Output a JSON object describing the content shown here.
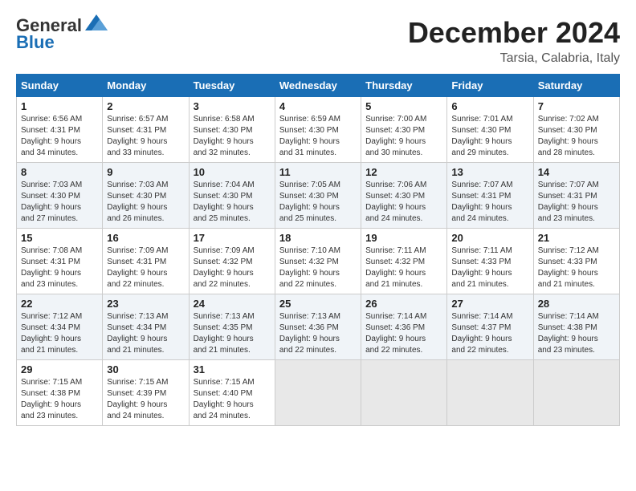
{
  "header": {
    "logo_line1": "General",
    "logo_line2": "Blue",
    "month": "December 2024",
    "location": "Tarsia, Calabria, Italy"
  },
  "weekdays": [
    "Sunday",
    "Monday",
    "Tuesday",
    "Wednesday",
    "Thursday",
    "Friday",
    "Saturday"
  ],
  "weeks": [
    [
      {
        "day": "1",
        "info": "Sunrise: 6:56 AM\nSunset: 4:31 PM\nDaylight: 9 hours\nand 34 minutes."
      },
      {
        "day": "2",
        "info": "Sunrise: 6:57 AM\nSunset: 4:31 PM\nDaylight: 9 hours\nand 33 minutes."
      },
      {
        "day": "3",
        "info": "Sunrise: 6:58 AM\nSunset: 4:30 PM\nDaylight: 9 hours\nand 32 minutes."
      },
      {
        "day": "4",
        "info": "Sunrise: 6:59 AM\nSunset: 4:30 PM\nDaylight: 9 hours\nand 31 minutes."
      },
      {
        "day": "5",
        "info": "Sunrise: 7:00 AM\nSunset: 4:30 PM\nDaylight: 9 hours\nand 30 minutes."
      },
      {
        "day": "6",
        "info": "Sunrise: 7:01 AM\nSunset: 4:30 PM\nDaylight: 9 hours\nand 29 minutes."
      },
      {
        "day": "7",
        "info": "Sunrise: 7:02 AM\nSunset: 4:30 PM\nDaylight: 9 hours\nand 28 minutes."
      }
    ],
    [
      {
        "day": "8",
        "info": "Sunrise: 7:03 AM\nSunset: 4:30 PM\nDaylight: 9 hours\nand 27 minutes."
      },
      {
        "day": "9",
        "info": "Sunrise: 7:03 AM\nSunset: 4:30 PM\nDaylight: 9 hours\nand 26 minutes."
      },
      {
        "day": "10",
        "info": "Sunrise: 7:04 AM\nSunset: 4:30 PM\nDaylight: 9 hours\nand 25 minutes."
      },
      {
        "day": "11",
        "info": "Sunrise: 7:05 AM\nSunset: 4:30 PM\nDaylight: 9 hours\nand 25 minutes."
      },
      {
        "day": "12",
        "info": "Sunrise: 7:06 AM\nSunset: 4:30 PM\nDaylight: 9 hours\nand 24 minutes."
      },
      {
        "day": "13",
        "info": "Sunrise: 7:07 AM\nSunset: 4:31 PM\nDaylight: 9 hours\nand 24 minutes."
      },
      {
        "day": "14",
        "info": "Sunrise: 7:07 AM\nSunset: 4:31 PM\nDaylight: 9 hours\nand 23 minutes."
      }
    ],
    [
      {
        "day": "15",
        "info": "Sunrise: 7:08 AM\nSunset: 4:31 PM\nDaylight: 9 hours\nand 23 minutes."
      },
      {
        "day": "16",
        "info": "Sunrise: 7:09 AM\nSunset: 4:31 PM\nDaylight: 9 hours\nand 22 minutes."
      },
      {
        "day": "17",
        "info": "Sunrise: 7:09 AM\nSunset: 4:32 PM\nDaylight: 9 hours\nand 22 minutes."
      },
      {
        "day": "18",
        "info": "Sunrise: 7:10 AM\nSunset: 4:32 PM\nDaylight: 9 hours\nand 22 minutes."
      },
      {
        "day": "19",
        "info": "Sunrise: 7:11 AM\nSunset: 4:32 PM\nDaylight: 9 hours\nand 21 minutes."
      },
      {
        "day": "20",
        "info": "Sunrise: 7:11 AM\nSunset: 4:33 PM\nDaylight: 9 hours\nand 21 minutes."
      },
      {
        "day": "21",
        "info": "Sunrise: 7:12 AM\nSunset: 4:33 PM\nDaylight: 9 hours\nand 21 minutes."
      }
    ],
    [
      {
        "day": "22",
        "info": "Sunrise: 7:12 AM\nSunset: 4:34 PM\nDaylight: 9 hours\nand 21 minutes."
      },
      {
        "day": "23",
        "info": "Sunrise: 7:13 AM\nSunset: 4:34 PM\nDaylight: 9 hours\nand 21 minutes."
      },
      {
        "day": "24",
        "info": "Sunrise: 7:13 AM\nSunset: 4:35 PM\nDaylight: 9 hours\nand 21 minutes."
      },
      {
        "day": "25",
        "info": "Sunrise: 7:13 AM\nSunset: 4:36 PM\nDaylight: 9 hours\nand 22 minutes."
      },
      {
        "day": "26",
        "info": "Sunrise: 7:14 AM\nSunset: 4:36 PM\nDaylight: 9 hours\nand 22 minutes."
      },
      {
        "day": "27",
        "info": "Sunrise: 7:14 AM\nSunset: 4:37 PM\nDaylight: 9 hours\nand 22 minutes."
      },
      {
        "day": "28",
        "info": "Sunrise: 7:14 AM\nSunset: 4:38 PM\nDaylight: 9 hours\nand 23 minutes."
      }
    ],
    [
      {
        "day": "29",
        "info": "Sunrise: 7:15 AM\nSunset: 4:38 PM\nDaylight: 9 hours\nand 23 minutes."
      },
      {
        "day": "30",
        "info": "Sunrise: 7:15 AM\nSunset: 4:39 PM\nDaylight: 9 hours\nand 24 minutes."
      },
      {
        "day": "31",
        "info": "Sunrise: 7:15 AM\nSunset: 4:40 PM\nDaylight: 9 hours\nand 24 minutes."
      },
      null,
      null,
      null,
      null
    ]
  ]
}
